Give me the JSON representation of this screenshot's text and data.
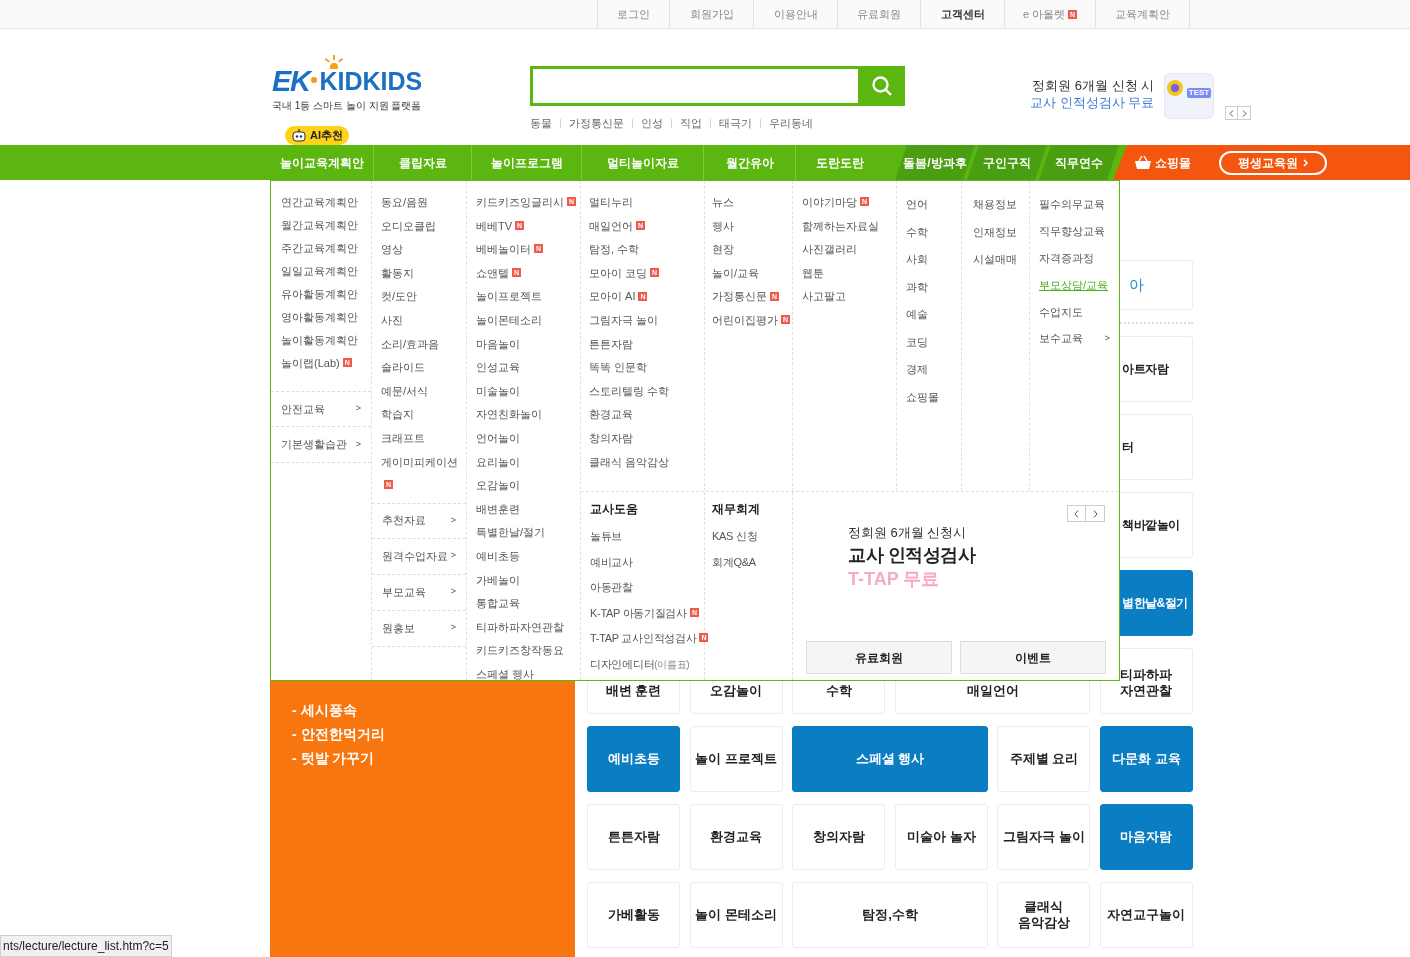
{
  "top_links": [
    {
      "label": "로그인",
      "bold": false
    },
    {
      "label": "회원가입",
      "bold": false
    },
    {
      "label": "이용안내",
      "bold": false
    },
    {
      "label": "유료회원",
      "bold": false
    },
    {
      "label": "고객센터",
      "bold": true
    },
    {
      "label": "e 아올렛",
      "bold": false,
      "badge": "N"
    },
    {
      "label": "교육계획안",
      "bold": false
    }
  ],
  "logo": {
    "mark": "EK",
    "name": "KIDKIDS",
    "tagline": "국내 1등 스마트 놀이 지원 플랫폼"
  },
  "search": {
    "keywords": [
      "동물",
      "가정통신문",
      "인성",
      "직업",
      "태극기",
      "우리동네"
    ]
  },
  "promo": {
    "line1": "정회원 6개월 신청 시",
    "line2": "교사 인적성검사 무료",
    "badge": "TEST"
  },
  "nav": {
    "ai_badge": "AI추천",
    "items": [
      {
        "label": "놀이교육계획안",
        "kind": "main"
      },
      {
        "label": "클립자료",
        "kind": "main"
      },
      {
        "label": "놀이프로그램",
        "kind": "main"
      },
      {
        "label": "멀티놀이자료",
        "kind": "main"
      },
      {
        "label": "월간유아",
        "kind": "main"
      },
      {
        "label": "도란도란",
        "kind": "main"
      },
      {
        "label": "돌봄/방과후",
        "kind": "tab"
      },
      {
        "label": "구인구직",
        "kind": "tab"
      },
      {
        "label": "직무연수",
        "kind": "tab"
      },
      {
        "label": "쇼핑몰",
        "kind": "shop"
      },
      {
        "label": "평생교육원",
        "kind": "pill"
      }
    ]
  },
  "mega_menu": {
    "columns": [
      {
        "items": [
          {
            "label": "연간교육계획안"
          },
          {
            "label": "월간교육계획안"
          },
          {
            "label": "주간교육계획안"
          },
          {
            "label": "일일교육계획안"
          },
          {
            "label": "유아활동계획안"
          },
          {
            "label": "영아활동계획안"
          },
          {
            "label": "놀이활동계획안"
          },
          {
            "label": "놀이랩(Lab)",
            "badge": "N"
          }
        ],
        "sections": [
          {
            "label": "안전교육",
            "arrow": ">"
          },
          {
            "label": "기본생활습관",
            "arrow": ">"
          }
        ]
      },
      {
        "items": [
          {
            "label": "동요/음원"
          },
          {
            "label": "오디오클립"
          },
          {
            "label": "영상"
          },
          {
            "label": "활동지"
          },
          {
            "label": "컷/도안"
          },
          {
            "label": "사진"
          },
          {
            "label": "소리/효과음"
          },
          {
            "label": "슬라이드"
          },
          {
            "label": "예문/서식"
          },
          {
            "label": "학습지"
          },
          {
            "label": "크래프트"
          },
          {
            "label": "게이미피케이션",
            "badge": "N"
          }
        ],
        "sections": [
          {
            "label": "추천자료",
            "arrow": ">"
          },
          {
            "label": "원격수업자료",
            "arrow": ">"
          },
          {
            "label": "부모교육",
            "arrow": ">"
          },
          {
            "label": "원홍보",
            "arrow": ">"
          }
        ]
      },
      {
        "items": [
          {
            "label": "키드키즈잉글리시",
            "badge": "N"
          },
          {
            "label": "베베TV",
            "badge": "N"
          },
          {
            "label": "베베놀이터",
            "badge": "N"
          },
          {
            "label": "쇼앤텔",
            "badge": "N"
          },
          {
            "label": "놀이프로젝트"
          },
          {
            "label": "놀이몬테소리"
          },
          {
            "label": "마음놀이"
          },
          {
            "label": "인성교육"
          },
          {
            "label": "미술놀이"
          },
          {
            "label": "자연친화놀이"
          },
          {
            "label": "언어놀이"
          },
          {
            "label": "요리놀이"
          },
          {
            "label": "오감놀이"
          },
          {
            "label": "배변훈련"
          },
          {
            "label": "특별한날/절기"
          },
          {
            "label": "예비초등"
          },
          {
            "label": "가베놀이"
          },
          {
            "label": "통합교육"
          },
          {
            "label": "티파하파자연관찰"
          },
          {
            "label": "키드키즈창작동요"
          },
          {
            "label": "스페셜 행사"
          }
        ]
      },
      {
        "items": [
          {
            "label": "멀티누리"
          },
          {
            "label": "매일언어",
            "badge": "N"
          },
          {
            "label": "탐정, 수학"
          },
          {
            "label": "모아이 코딩",
            "badge": "N"
          },
          {
            "label": "모아이 AI",
            "badge": "N"
          },
          {
            "label": "그림자극 놀이"
          },
          {
            "label": "튼튼자람"
          },
          {
            "label": "똑똑 인문학"
          },
          {
            "label": "스토리텔링 수학"
          },
          {
            "label": "환경교육"
          },
          {
            "label": "창의자람"
          },
          {
            "label": "클래식 음악감상"
          }
        ]
      },
      {
        "items": [
          {
            "label": "뉴스"
          },
          {
            "label": "행사"
          },
          {
            "label": "현장"
          },
          {
            "label": "놀이/교육"
          },
          {
            "label": "가정통신문",
            "badge": "N"
          },
          {
            "label": "어린이집평가",
            "badge": "N"
          }
        ]
      },
      {
        "items": [
          {
            "label": "이야기마당",
            "badge": "N"
          },
          {
            "label": "함께하는자료실"
          },
          {
            "label": "사진갤러리"
          },
          {
            "label": "웹툰"
          },
          {
            "label": "사고팔고"
          }
        ]
      },
      {
        "items": [
          {
            "label": "언어"
          },
          {
            "label": "수학"
          },
          {
            "label": "사회"
          },
          {
            "label": "과학"
          },
          {
            "label": "예술"
          },
          {
            "label": "코딩"
          },
          {
            "label": "경제"
          },
          {
            "label": "쇼핑몰"
          }
        ]
      },
      {
        "items": [
          {
            "label": "채용정보"
          },
          {
            "label": "인재정보"
          },
          {
            "label": "시설매매"
          }
        ]
      },
      {
        "items": [
          {
            "label": "필수의무교육",
            "selected": false
          },
          {
            "label": "직무향상교육",
            "selected": false
          },
          {
            "label": "자격증과정",
            "selected": false
          },
          {
            "label": "부모상담/교육",
            "selected": true
          },
          {
            "label": "수업지도",
            "selected": false
          },
          {
            "label": "보수교육",
            "selected": false,
            "arrow": ">"
          }
        ]
      }
    ],
    "groups": [
      {
        "heading": "교사도움",
        "items": [
          {
            "label": "놀튜브"
          },
          {
            "label": "예비교사"
          },
          {
            "label": "아동관찰"
          },
          {
            "label": "K-TAP 아동기질검사",
            "badge": "N"
          },
          {
            "label": "T-TAP 교사인적성검사",
            "badge": "N"
          },
          {
            "label": "디자인에디터",
            "note": "(이름표)"
          }
        ]
      },
      {
        "heading": "재무회계",
        "items": [
          {
            "label": "KAS 신청"
          },
          {
            "label": "회계Q&A"
          }
        ]
      }
    ],
    "promo": {
      "line1": "정회원 6개월 신청시",
      "line2": "교사 인적성검사",
      "line3": "T-TAP 무료",
      "buttons": [
        "유료회원",
        "이벤트"
      ]
    }
  },
  "side_panel": {
    "items": [
      "- 세시풍속",
      "- 안전한먹거리",
      "- 텃밭 가꾸기"
    ]
  },
  "side_tiles": [
    {
      "label": "아",
      "kind": "title"
    },
    {
      "label": "아트자람",
      "kind": "tile",
      "highlight": false
    },
    {
      "label": "터",
      "kind": "tile",
      "highlight": false
    },
    {
      "label": "책바깥놀이",
      "kind": "tile",
      "highlight": false
    },
    {
      "label": "별한날&절기",
      "kind": "tile",
      "highlight": true
    }
  ],
  "tile_rows": [
    [
      {
        "label": "배변 훈련",
        "highlight": false
      },
      {
        "label": "오감놀이",
        "highlight": false
      },
      {
        "label": "수학",
        "highlight": false
      },
      {
        "label": "매일언어",
        "highlight": false,
        "wide": true
      },
      {
        "label": "티파하파\n자연관찰",
        "highlight": false
      }
    ],
    [
      {
        "label": "예비초등",
        "highlight": true
      },
      {
        "label": "놀이 프로젝트",
        "highlight": false
      },
      {
        "label": "스페셜 행사",
        "highlight": true,
        "wide": true
      },
      {
        "label": "주제별 요리",
        "highlight": false
      },
      {
        "label": "다문화 교육",
        "highlight": true
      }
    ],
    [
      {
        "label": "튼튼자람",
        "highlight": false
      },
      {
        "label": "환경교육",
        "highlight": false
      },
      {
        "label": "창의자람",
        "highlight": false
      },
      {
        "label": "미술아 놀자",
        "highlight": false
      },
      {
        "label": "그림자극 놀이",
        "highlight": false
      },
      {
        "label": "마음자람",
        "highlight": true
      }
    ],
    [
      {
        "label": "가베활동",
        "highlight": false
      },
      {
        "label": "놀이 몬테소리",
        "highlight": false
      },
      {
        "label": "탐정,수학",
        "highlight": false,
        "wide": true
      },
      {
        "label": "클래식\n음악감상",
        "highlight": false
      },
      {
        "label": "자연교구놀이",
        "highlight": false
      }
    ]
  ],
  "status_bar": {
    "url": "nts/lecture/lecture_list.htm?c=5"
  }
}
